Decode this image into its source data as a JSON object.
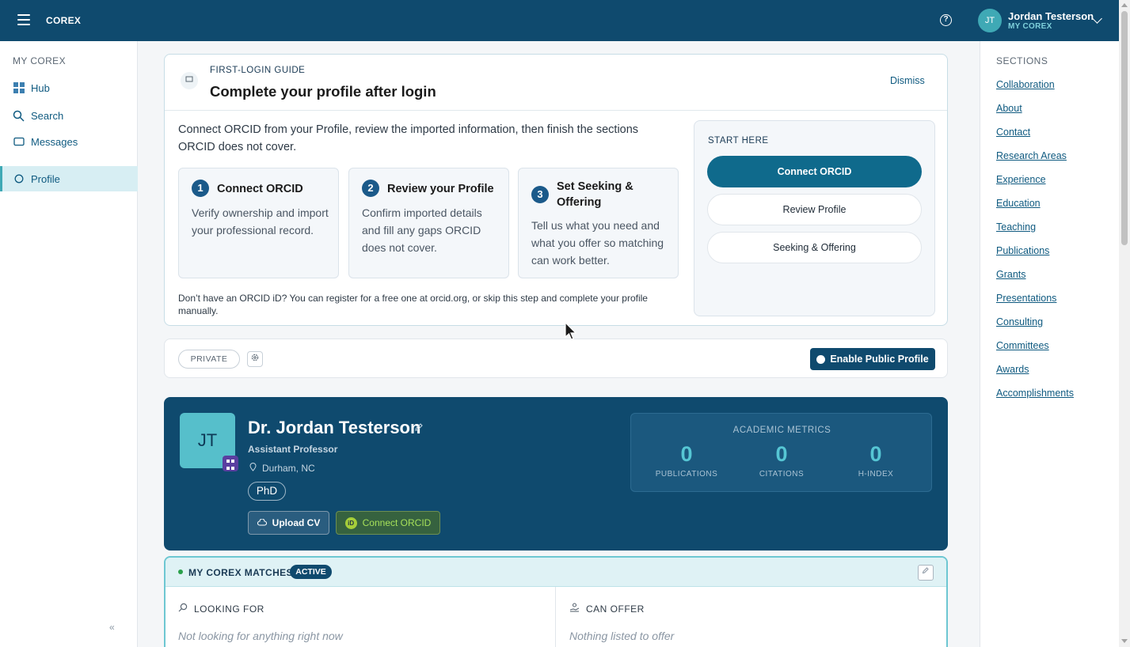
{
  "topbar": {
    "brand": "COREX",
    "help_glyph": "?",
    "avatar_initials": "JT",
    "user_name": "Jordan Testerson",
    "user_sub": "MY COREX",
    "icons": [
      "menu-icon",
      "help-icon",
      "chevron-down-icon"
    ]
  },
  "sidebar": {
    "title": "MY COREX",
    "items": [
      {
        "label": "Hub",
        "icon": "grid-icon"
      },
      {
        "label": "Search",
        "icon": "search-icon"
      },
      {
        "label": "Messages",
        "icon": "message-icon"
      },
      {
        "label": "Profile",
        "icon": "profile-icon",
        "active": true
      }
    ],
    "collapse_glyph": "«"
  },
  "guide": {
    "label": "FIRST-LOGIN GUIDE",
    "title": "Complete your profile after login",
    "dismiss": "Dismiss",
    "intro": "Connect ORCID from your Profile, review the imported information, then finish the sections ORCID does not cover.",
    "steps": [
      {
        "num": "1",
        "title": "Connect ORCID",
        "body": "Verify ownership and import your professional record."
      },
      {
        "num": "2",
        "title": "Review your Profile",
        "body": "Confirm imported details and fill any gaps ORCID does not cover."
      },
      {
        "num": "3",
        "title": "Set Seeking & Offering",
        "body": "Tell us what you need and what you offer so matching can work better."
      }
    ],
    "footnote": "Don’t have an ORCID iD? You can register for a free one at orcid.org, or skip this step and complete your profile manually.",
    "start_label": "START HERE",
    "start_buttons": [
      "Connect ORCID",
      "Review Profile",
      "Seeking & Offering"
    ]
  },
  "privacy": {
    "status": "PRIVATE",
    "enable_label": "Enable Public Profile"
  },
  "profile": {
    "initials": "JT",
    "name": "Dr. Jordan Testerson",
    "title": "Assistant Professor",
    "location": "Durham, NC",
    "degree": "PhD",
    "upload_cv": "Upload CV",
    "connect_orcid": "Connect ORCID",
    "orcid_glyph": "iD",
    "metrics_title": "ACADEMIC METRICS",
    "metrics": [
      {
        "value": "0",
        "label": "PUBLICATIONS"
      },
      {
        "value": "0",
        "label": "CITATIONS"
      },
      {
        "value": "0",
        "label": "H-INDEX"
      }
    ]
  },
  "matches": {
    "title": "MY COREX MATCHES",
    "status": "ACTIVE",
    "looking_for_label": "LOOKING FOR",
    "looking_for_empty": "Not looking for anything right now",
    "can_offer_label": "CAN OFFER",
    "can_offer_empty": "Nothing listed to offer"
  },
  "sections": {
    "title": "SECTIONS",
    "links": [
      "Collaboration",
      "About",
      "Contact",
      "Research Areas",
      "Experience",
      "Education",
      "Teaching",
      "Publications",
      "Grants",
      "Presentations",
      "Consulting",
      "Committees",
      "Awards",
      "Accomplishments"
    ]
  },
  "colors": {
    "topbar": "#0f4a6e",
    "accent": "#0f6a8c",
    "teal": "#56bfcb",
    "orcid_green": "#a6ce39"
  }
}
